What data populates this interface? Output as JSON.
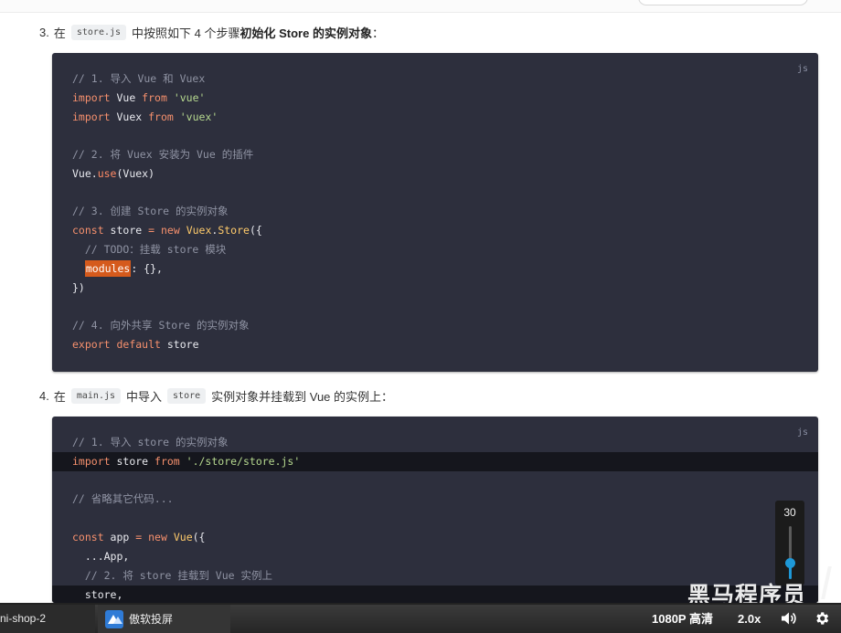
{
  "step3": {
    "num": "3.",
    "pre": "在",
    "code": "store.js",
    "mid": "中按照如下 4 个步骤",
    "bold": "初始化 Store 的实例对象",
    "end": "："
  },
  "code1": {
    "lang": "js",
    "lines": {
      "l1": "// 1. 导入 Vue 和 Vuex",
      "l4": "// 2. 将 Vuex 安装为 Vue 的插件",
      "l6": "// 3. 创建 Store 的实例对象",
      "l8": "  // TODO：挂载 store 模块",
      "l9_key": "modules",
      "l12": "// 4. 向外共享 Store 的实例对象"
    }
  },
  "step4": {
    "num": "4.",
    "pre": "在",
    "code1": "main.js",
    "mid": "中导入",
    "code2": "store",
    "end": "实例对象并挂载到 Vue 的实例上："
  },
  "code2": {
    "lang": "js",
    "lines": {
      "l1": "// 1. 导入 store 的实例对象",
      "l2_path": "'./store/store.js'",
      "l3": "// 省略其它代码...",
      "l6": "  // 2. 将 store 挂载到 Vue 实例上",
      "l7": "  store,"
    }
  },
  "volume_popup": {
    "value": "30",
    "level": 0.3
  },
  "watermark": "黑马程序员",
  "taskbar": {
    "item1": "ni-shop-2",
    "item2": "傲软投屏"
  },
  "player": {
    "quality": "1080P 高清",
    "speed": "2.0x",
    "volume_icon": "speaker-icon",
    "settings_icon": "gear-icon"
  },
  "colors": {
    "code_bg": "#2d2f3d",
    "keyword": "#f6906d",
    "string": "#b6d98f",
    "class": "#ffcb6b",
    "comment": "#8f93a3",
    "selection": "#d55a1c",
    "accent": "#1e98d7"
  }
}
